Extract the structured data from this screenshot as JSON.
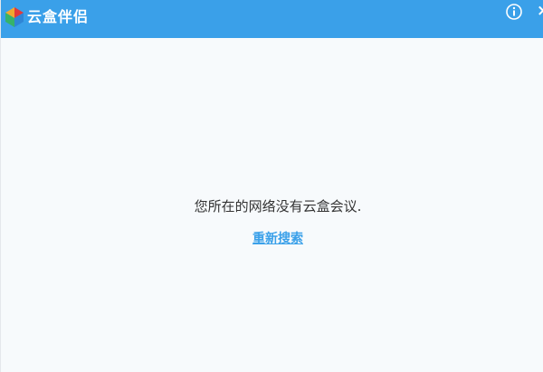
{
  "window": {
    "title": "云盒伴侣",
    "info_icon": "info-circle-icon",
    "close_label": "×",
    "titlebar_color": "#3aa0e9"
  },
  "main": {
    "message": "您所在的网络没有云盒会议.",
    "retry_link": "重新搜索"
  },
  "colors": {
    "accent": "#3aa0e9",
    "background": "#f7fafc",
    "text": "#333333"
  }
}
